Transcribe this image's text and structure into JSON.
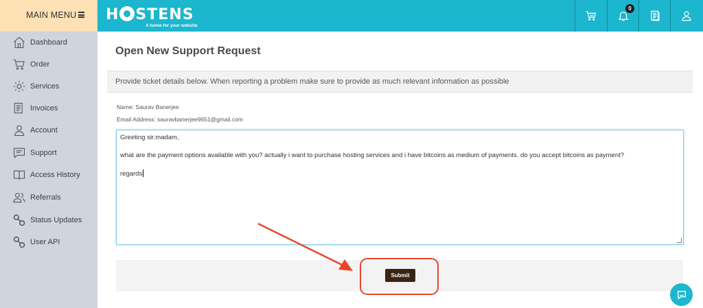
{
  "menu": {
    "title": "MAIN MENU"
  },
  "brand": {
    "name": "HOSTENS",
    "name_left": "H",
    "name_right": "STENS",
    "tagline": "A home for your website",
    "color": "#1cb6ce"
  },
  "topbar": {
    "cart_icon": "cart-icon",
    "notifications_icon": "bell-icon",
    "notifications_count": "0",
    "invoices_icon": "document-icon",
    "account_icon": "user-icon"
  },
  "sidebar": {
    "items": [
      {
        "label": "Dashboard",
        "icon": "home-icon"
      },
      {
        "label": "Order",
        "icon": "cart-icon"
      },
      {
        "label": "Services",
        "icon": "gear-icon"
      },
      {
        "label": "Invoices",
        "icon": "document-icon"
      },
      {
        "label": "Account",
        "icon": "user-icon"
      },
      {
        "label": "Support",
        "icon": "chat-icon"
      },
      {
        "label": "Access History",
        "icon": "book-icon"
      },
      {
        "label": "Referrals",
        "icon": "users-icon"
      },
      {
        "label": "Status Updates",
        "icon": "link-icon"
      },
      {
        "label": "User API",
        "icon": "link-icon"
      }
    ]
  },
  "page": {
    "title": "Open New Support Request",
    "info": "Provide ticket details below. When reporting a problem make sure to provide as much relevant information as possible",
    "name_line": "Name: Saurav Banerjee",
    "email_line": "Email Address: sauravbanerjee9651@gmail.com",
    "message": {
      "line1": "Greeting sir.madam,",
      "line2": "what are the payment options available with you? actually i want to purchase hosting services and i have bitcoins as medium of payments. do you accept bitcoins as payment?",
      "line3": "regards"
    },
    "submit_label": "Submit"
  },
  "annotation": {
    "color": "#e8462c"
  }
}
